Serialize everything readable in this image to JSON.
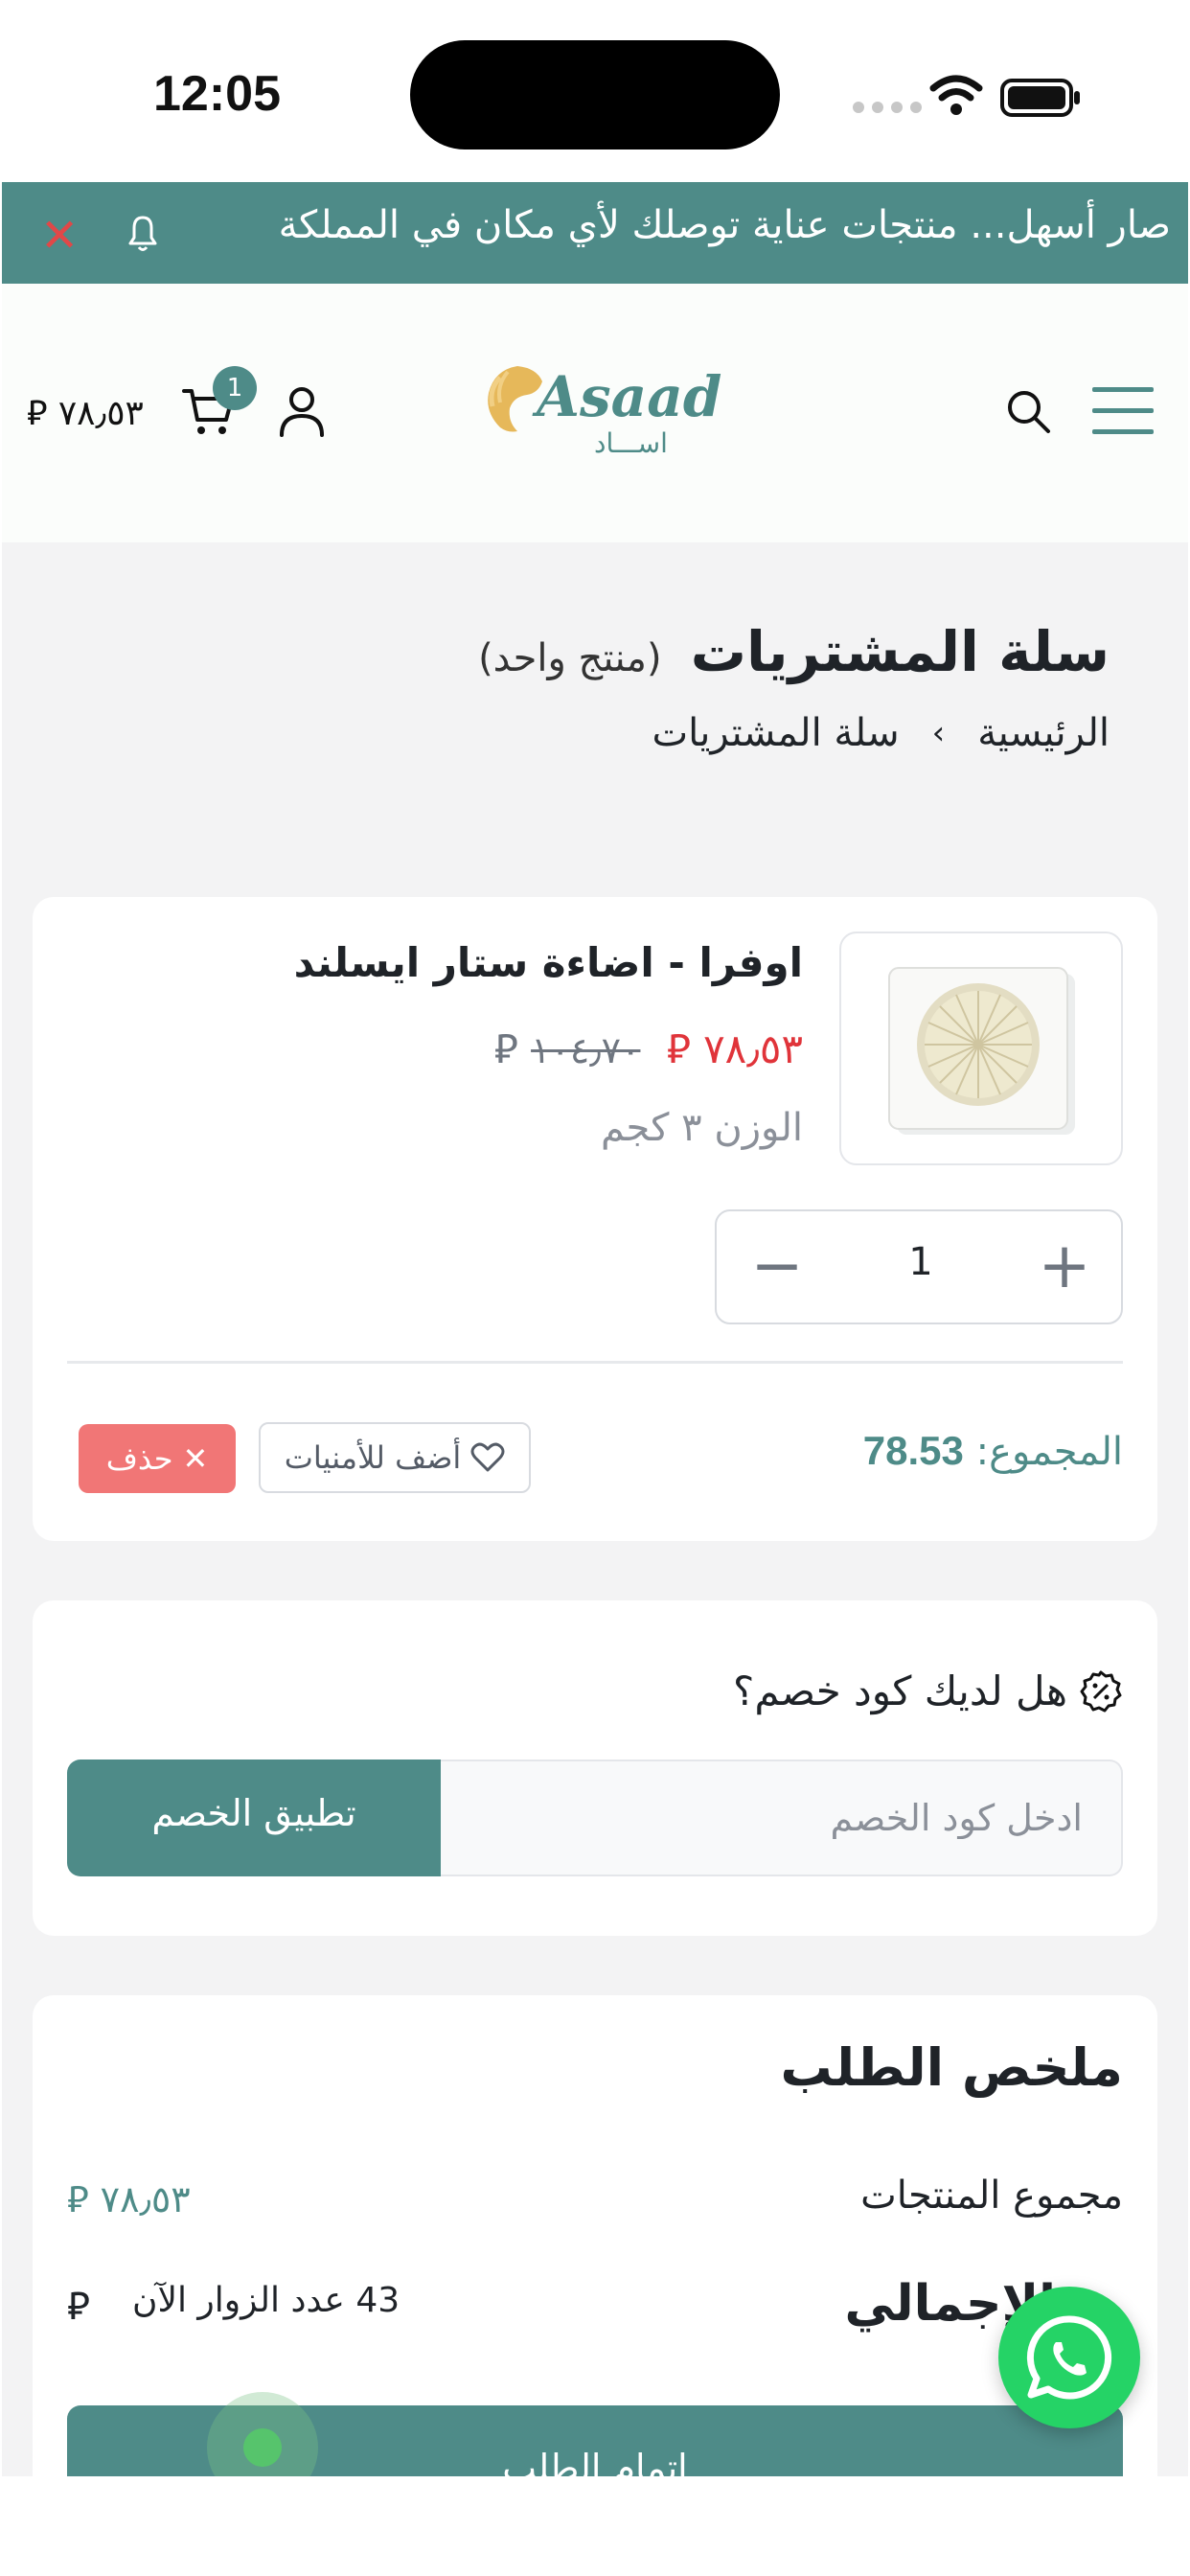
{
  "status_bar": {
    "time": "12:05"
  },
  "announcement": {
    "text": "صار أسهل... منتجات عناية توصلك لأي مكان في المملكة"
  },
  "header": {
    "logo_text": "Asaad",
    "logo_subtext": "اســـاد",
    "cart_count": "1",
    "cart_total": "٧٨٫٥٣"
  },
  "page": {
    "title": "سلة المشتريات",
    "title_count": "(منتج واحد)",
    "breadcrumb": {
      "home": "الرئيسية",
      "separator": "›",
      "current": "سلة المشتريات"
    }
  },
  "cart_item": {
    "name": "اوفرا - اضاءة ستار ايسلند",
    "price": "٧٨٫٥٣",
    "old_price": "١٠٤٫٧٠",
    "weight": "الوزن ٣ كجم",
    "quantity": "1",
    "subtotal_label": "المجموع:",
    "subtotal_value": "78.53",
    "wishlist_label": "أضف للأمنيات",
    "delete_label": "حذف"
  },
  "coupon": {
    "question": "هل لديك كود خصم؟",
    "placeholder": "ادخل كود الخصم",
    "apply_label": "تطبيق الخصم"
  },
  "summary": {
    "title": "ملخص الطلب",
    "items_total_label": "مجموع المنتجات",
    "items_total_value": "٧٨٫٥٣",
    "total_label": "الإجمالي",
    "visitors_text": "43 عدد الزوار الآن",
    "checkout_label": "اتمام الطلب"
  },
  "colors": {
    "brand": "#4e8b88",
    "sale_price": "#e0343a",
    "delete": "#f17676",
    "whatsapp": "#25d366"
  },
  "icons": [
    "bell-icon",
    "close-icon",
    "menu-icon",
    "search-icon",
    "user-icon",
    "cart-icon",
    "riyal-icon",
    "heart-icon",
    "discount-icon",
    "whatsapp-icon"
  ]
}
